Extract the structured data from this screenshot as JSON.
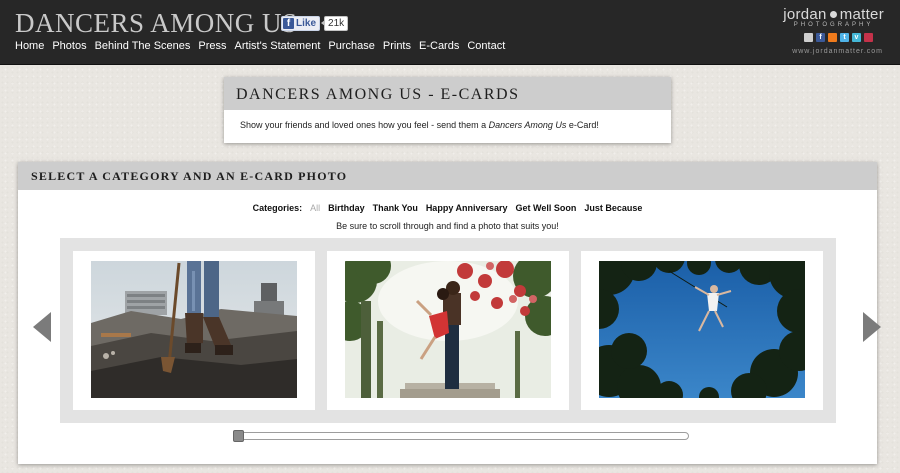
{
  "header": {
    "site_title": "DANCERS AMONG US",
    "facebook": {
      "like_label": "Like",
      "count": "21k",
      "icon": "facebook-f-icon"
    },
    "nav": [
      "Home",
      "Photos",
      "Behind The Scenes",
      "Press",
      "Artist's Statement",
      "Purchase",
      "Prints",
      "E-Cards",
      "Contact"
    ],
    "brand": {
      "name_first": "jordan",
      "name_last": "matter",
      "subtitle": "PHOTOGRAPHY",
      "url": "www.jordanmatter.com"
    },
    "social_icons": [
      {
        "name": "email-icon",
        "color": "#cfcfcf"
      },
      {
        "name": "facebook-icon",
        "color": "#3b5998"
      },
      {
        "name": "rss-icon",
        "color": "#f07b1c"
      },
      {
        "name": "twitter-icon",
        "color": "#4fb3e8"
      },
      {
        "name": "vimeo-icon",
        "color": "#44b7d6"
      },
      {
        "name": "instagram-icon",
        "color": "#c4324a"
      }
    ]
  },
  "intro": {
    "title": "DANCERS AMONG US - E-CARDS",
    "text_before": "Show your friends and loved ones how you feel - send them a ",
    "text_em": "Dancers Among Us",
    "text_after": " e-Card!"
  },
  "main": {
    "title": "SELECT A CATEGORY AND AN E-CARD PHOTO",
    "categories_label": "Categories:",
    "categories": [
      "All",
      "Birthday",
      "Thank You",
      "Happy Anniversary",
      "Get Well Soon",
      "Just Because"
    ],
    "active_category": "All",
    "hint": "Be sure to scroll through and find a photo that suits you!",
    "photos": [
      "construction-site-dancer-photo",
      "couple-kissing-garden-photo",
      "dancer-leaping-trees-photo"
    ],
    "scroll_position": 0
  },
  "colors": {
    "header_bg": "#272727",
    "panel_head": "#cdcdcd",
    "arrow": "#7b7b7b"
  }
}
